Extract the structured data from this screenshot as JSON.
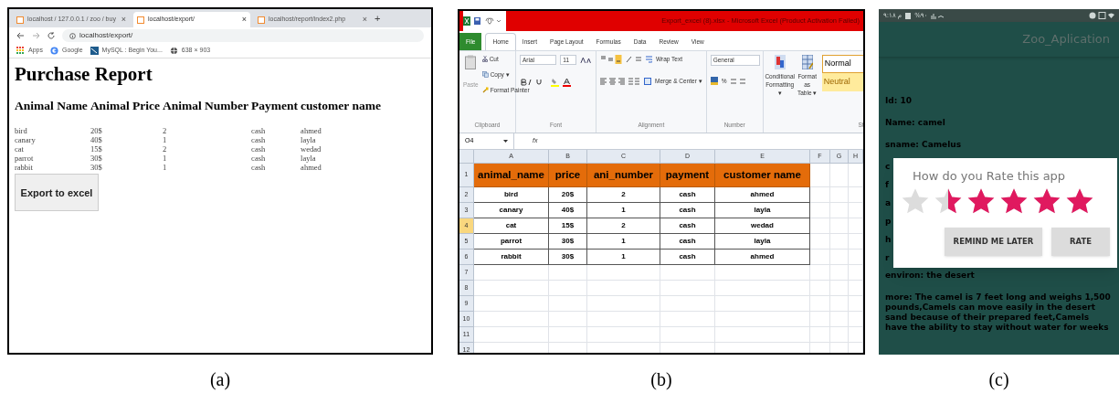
{
  "captions": [
    "(a)",
    "(b)",
    "(c)"
  ],
  "browser": {
    "tabs": [
      {
        "label": "localhost / 127.0.0.1 / zoo / buy",
        "selected": false
      },
      {
        "label": "localhost/export/",
        "selected": true
      },
      {
        "label": "localhost/report/index2.php",
        "selected": false
      }
    ],
    "tab_close": "×",
    "new_tab": "+",
    "address": "localhost/export/",
    "bookmarks": [
      {
        "kind": "apps",
        "label": "Apps"
      },
      {
        "kind": "google",
        "label": "Google"
      },
      {
        "kind": "mysql",
        "label": "MySQL : Begin You..."
      },
      {
        "kind": "globe",
        "label": "638 × 903"
      }
    ],
    "heading": "Purchase Report",
    "columns": [
      "Animal Name",
      "Animal Price",
      "Animal Number",
      "Payment",
      "customer name"
    ],
    "rows": [
      [
        "bird",
        "20$",
        "2",
        "cash",
        "ahmed"
      ],
      [
        "canary",
        "40$",
        "1",
        "cash",
        "layla"
      ],
      [
        "cat",
        "15$",
        "2",
        "cash",
        "wedad"
      ],
      [
        "parrot",
        "30$",
        "1",
        "cash",
        "layla"
      ],
      [
        "rabbit",
        "30$",
        "1",
        "cash",
        "ahmed"
      ]
    ],
    "button": "Export to excel"
  },
  "excel": {
    "title": "Export_excel (8).xlsx - Microsoft Excel (Product Activation Failed)",
    "ribbon_tabs": [
      {
        "label": "File",
        "selected": false
      },
      {
        "label": "Home",
        "selected": true
      },
      {
        "label": "Insert",
        "selected": false
      },
      {
        "label": "Page Layout",
        "selected": false
      },
      {
        "label": "Formulas",
        "selected": false
      },
      {
        "label": "Data",
        "selected": false
      },
      {
        "label": "Review",
        "selected": false
      },
      {
        "label": "View",
        "selected": false
      }
    ],
    "clipboard": {
      "paste": "Paste",
      "cut": "Cut",
      "copy": "Copy ▾",
      "painter": "Format Painter",
      "group": "Clipboard"
    },
    "font": {
      "name": "Arial",
      "size": "11",
      "group": "Font"
    },
    "alignment": {
      "wrap": "Wrap Text",
      "merge": "Merge & Center ▾",
      "group": "Alignment"
    },
    "number": {
      "format": "General",
      "percent": "%",
      "group": "Number"
    },
    "styles": {
      "conditional": "Conditional Formatting ▾",
      "table": "Format as Table ▾",
      "normal": "Normal",
      "neutral": "Neutral",
      "group": "St"
    },
    "name_box": "O4",
    "fx": "fx",
    "column_letters": [
      "A",
      "B",
      "C",
      "D",
      "E",
      "F",
      "G",
      "H"
    ],
    "row_headers": [
      {
        "label": "1",
        "selected": false
      },
      {
        "label": "2",
        "selected": false
      },
      {
        "label": "3",
        "selected": false
      },
      {
        "label": "4",
        "selected": true
      },
      {
        "label": "5",
        "selected": false
      },
      {
        "label": "6",
        "selected": false
      },
      {
        "label": "7",
        "selected": false
      },
      {
        "label": "8",
        "selected": false
      },
      {
        "label": "9",
        "selected": false
      },
      {
        "label": "10",
        "selected": false
      },
      {
        "label": "11",
        "selected": false
      },
      {
        "label": "12",
        "selected": false
      }
    ],
    "header": [
      "animal_name",
      "price",
      "ani_number",
      "payment",
      "customer name"
    ],
    "rows": [
      [
        "bird",
        "20$",
        "2",
        "cash",
        "ahmed"
      ],
      [
        "canary",
        "40$",
        "1",
        "cash",
        "layla"
      ],
      [
        "cat",
        "15$",
        "2",
        "cash",
        "wedad"
      ],
      [
        "parrot",
        "30$",
        "1",
        "cash",
        "layla"
      ],
      [
        "rabbit",
        "30$",
        "1",
        "cash",
        "ahmed"
      ]
    ]
  },
  "phone": {
    "status_time": "م ٩:١٨",
    "battery": "%٩٠",
    "app_title": "Zoo_Aplication",
    "lines_top": [
      "Id: 10",
      "Name: camel",
      "sname: Camelus"
    ],
    "hidden_lines": [
      "c",
      "f",
      "a",
      "p",
      "h",
      "r"
    ],
    "lines_bottom": [
      "environ: the desert",
      "more: The camel is 7 feet long and weighs 1,500 pounds,Camels can move easily in the desert sand because of their prepared feet,Camels have the ability to stay without water for weeks"
    ],
    "dialog": {
      "title": "How do you Rate this app",
      "stars": 4.5,
      "buttons": [
        "REMIND ME LATER",
        "RATE"
      ]
    }
  }
}
